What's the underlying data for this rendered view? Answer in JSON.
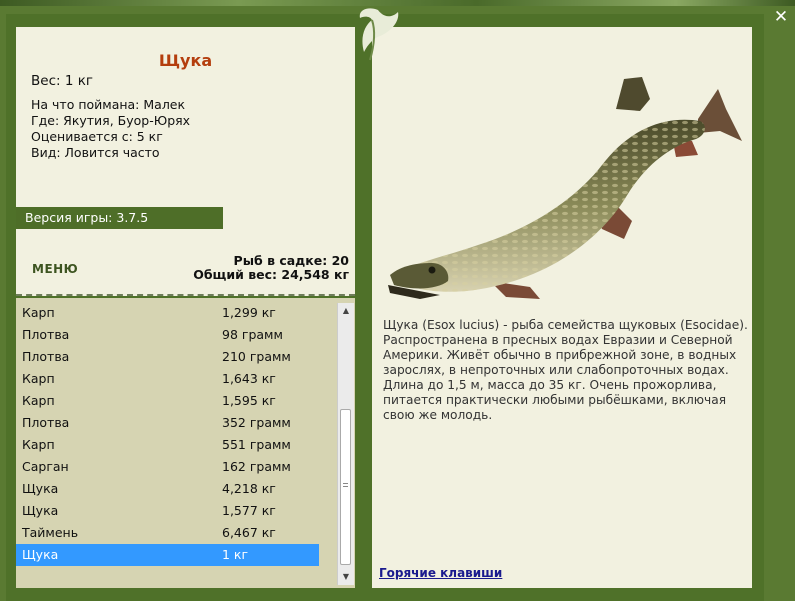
{
  "fish_card": {
    "name": "Щука",
    "weight_line": "Вес: 1 кг",
    "bait_line": "На что поймана: Малек",
    "location_line": "Где: Якутия, Буор-Юрях",
    "valued_line": "Оценивается с: 5 кг",
    "type_line": "Вид: Ловится часто"
  },
  "version": "Версия игры: 3.7.5",
  "menu_label": "МЕНЮ",
  "stats": {
    "in_keepnet": "Рыб в садке: 20",
    "total_weight": "Общий вес: 24,548 кг"
  },
  "catch_list": [
    {
      "name": "Карп",
      "weight": "1,299 кг"
    },
    {
      "name": "Плотва",
      "weight": "98 грамм"
    },
    {
      "name": "Плотва",
      "weight": "210 грамм"
    },
    {
      "name": "Карп",
      "weight": "1,643 кг"
    },
    {
      "name": "Карп",
      "weight": "1,595 кг"
    },
    {
      "name": "Плотва",
      "weight": "352 грамм"
    },
    {
      "name": "Карп",
      "weight": "551 грамм"
    },
    {
      "name": "Сарган",
      "weight": "162 грамм"
    },
    {
      "name": "Щука",
      "weight": "4,218 кг"
    },
    {
      "name": "Щука",
      "weight": "1,577 кг"
    },
    {
      "name": "Таймень",
      "weight": "6,467 кг"
    },
    {
      "name": "Щука",
      "weight": "1 кг",
      "selected": true
    }
  ],
  "description": "Щука (Esox lucius) - рыба семейства щуковых (Esocidae). Распространена в пресных водах Евразии и Северной Америки. Живёт обычно в прибрежной зоне, в водных зарослях, в непроточных или слабопроточных водах. Длина до 1,5 м, масса до 35 кг. Очень прожорлива, питается практически любыми рыбёшками, включая свою же молодь.",
  "hotkeys_label": "Горячие клавиши",
  "colors": {
    "background": "#5a7a32",
    "panel": "#f2f1e0",
    "list_bg": "#d6d4b2",
    "title": "#b43e0e",
    "selection": "#3399ff",
    "version_bar": "#4e6e28"
  },
  "icons": {
    "leaf": "leaf-icon",
    "close": "close-icon",
    "scroll_up": "scroll-up-icon",
    "scroll_down": "scroll-down-icon"
  }
}
